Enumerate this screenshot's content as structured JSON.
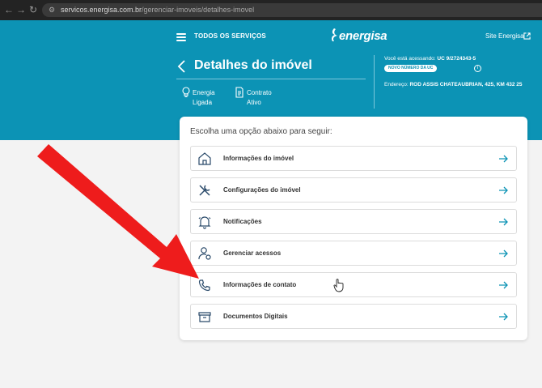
{
  "browser": {
    "url_host": "servicos.energisa.com.br",
    "url_path": "/gerenciar-imoveis/detalhes-imovel"
  },
  "header": {
    "menu_label": "TODOS OS SERVIÇOS",
    "logo_text": "energisa",
    "site_link": "Site Energisa"
  },
  "page": {
    "title": "Detalhes do imóvel",
    "status": [
      {
        "label": "Energia",
        "value": "Ligada",
        "icon": "lightbulb-icon"
      },
      {
        "label": "Contrato",
        "value": "Ativo",
        "icon": "document-icon"
      }
    ],
    "account": {
      "accessing_prefix": "Você está acessando:",
      "uc": "UC 9/2724343-5",
      "badge": "NOVO NÚMERO DA UC",
      "address_prefix": "Endereço:",
      "address": "ROD ASSIS CHATEAUBRIAN, 425, KM 432 25"
    }
  },
  "options": {
    "prompt": "Escolha uma opção abaixo para seguir:",
    "items": [
      {
        "label": "Informações do imóvel",
        "icon": "house-icon"
      },
      {
        "label": "Configurações do imóvel",
        "icon": "tools-icon"
      },
      {
        "label": "Notificações",
        "icon": "bell-icon"
      },
      {
        "label": "Gerenciar acessos",
        "icon": "user-settings-icon"
      },
      {
        "label": "Informações de contato",
        "icon": "phone-icon"
      },
      {
        "label": "Documentos Digitais",
        "icon": "archive-icon"
      }
    ]
  },
  "colors": {
    "brand": "#0c93b5",
    "annotation_arrow": "#ee1c1c"
  }
}
